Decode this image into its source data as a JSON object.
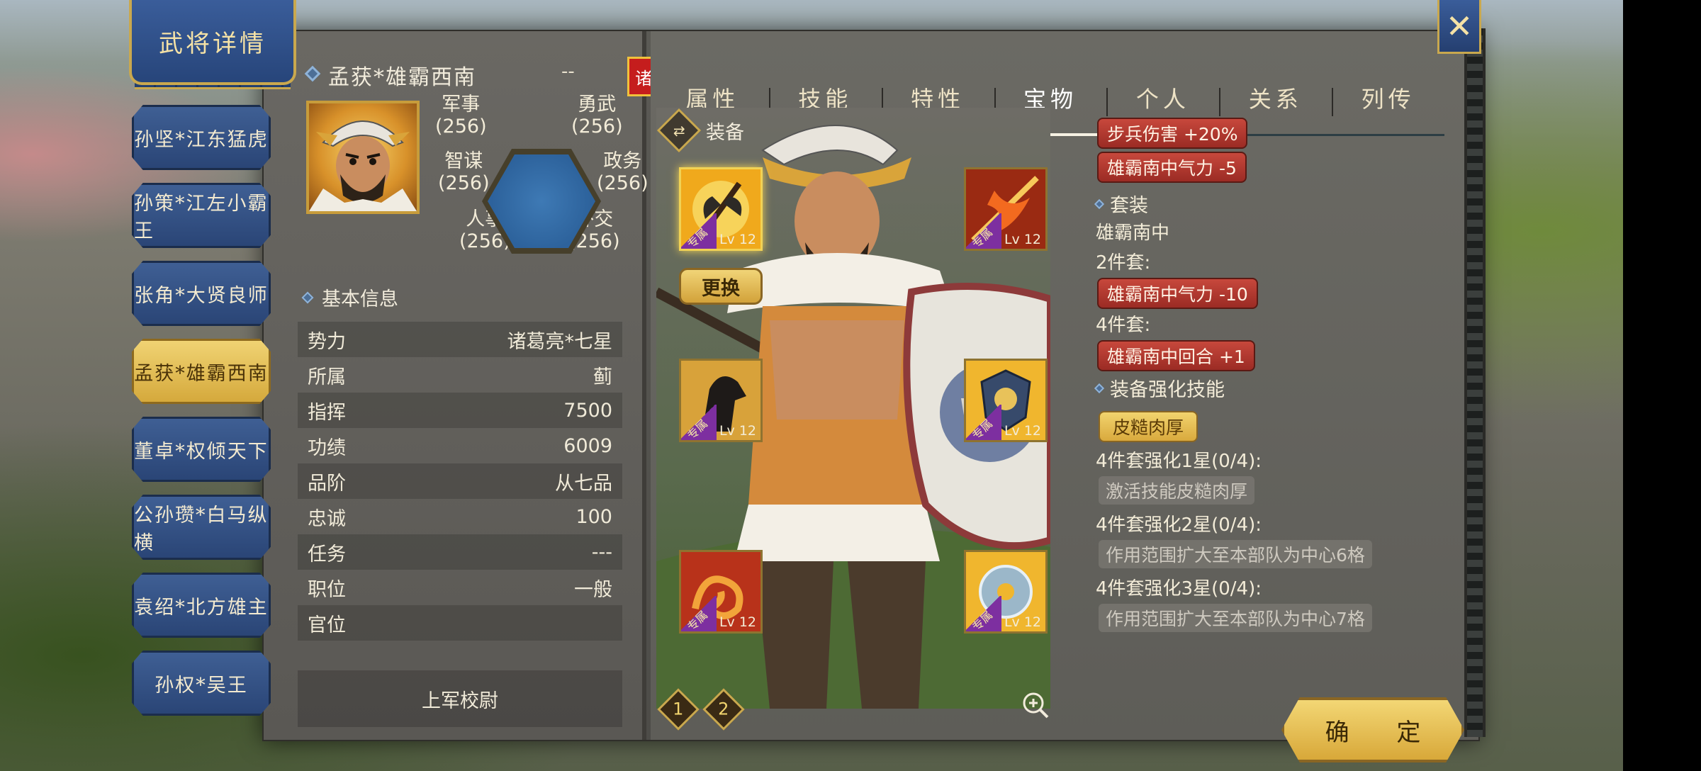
{
  "header": {
    "title": "武将详情"
  },
  "sidebar": {
    "heroes": [
      {
        "label": "孙坚*江东猛虎",
        "active": false
      },
      {
        "label": "孙策*江左小霸王",
        "active": false
      },
      {
        "label": "张角*大贤良师",
        "active": false
      },
      {
        "label": "孟获*雄霸西南",
        "active": true
      },
      {
        "label": "董卓*权倾天下",
        "active": false
      },
      {
        "label": "公孙瓒*白马纵横",
        "active": false
      },
      {
        "label": "袁绍*北方雄主",
        "active": false
      },
      {
        "label": "孙权*吴王",
        "active": false
      }
    ]
  },
  "hero": {
    "name": "孟获*雄霸西南",
    "dash": "--",
    "faction_badge": "诸",
    "stats": {
      "military": {
        "label": "军事",
        "value": "(256)"
      },
      "valor": {
        "label": "勇武",
        "value": "(256)"
      },
      "intellect": {
        "label": "智谋",
        "value": "(256)"
      },
      "politics": {
        "label": "政务",
        "value": "(256)"
      },
      "personnel": {
        "label": "人事",
        "value": "(256)"
      },
      "diplomacy": {
        "label": "外交",
        "value": "(256)"
      }
    }
  },
  "basic_info": {
    "title": "基本信息",
    "rows": [
      {
        "label": "势力",
        "value": "诸葛亮*七星"
      },
      {
        "label": "所属",
        "value": "蓟"
      },
      {
        "label": "指挥",
        "value": "7500"
      },
      {
        "label": "功绩",
        "value": "6009"
      },
      {
        "label": "品阶",
        "value": "从七品"
      },
      {
        "label": "忠诚",
        "value": "100"
      },
      {
        "label": "任务",
        "value": "---"
      },
      {
        "label": "职位",
        "value": "一般"
      },
      {
        "label": "官位",
        "value": ""
      }
    ],
    "rank": "上军校尉"
  },
  "tabs": [
    {
      "label": "属性",
      "active": false
    },
    {
      "label": "技能",
      "active": false
    },
    {
      "label": "特性",
      "active": false
    },
    {
      "label": "宝物",
      "active": true
    },
    {
      "label": "个人",
      "active": false
    },
    {
      "label": "关系",
      "active": false
    },
    {
      "label": "列传",
      "active": false
    }
  ],
  "equipment": {
    "title": "装备",
    "change_button": "更换",
    "exclusive_label": "专属",
    "slots": [
      {
        "icon": "axe-icon",
        "level": "Lv 12"
      },
      {
        "icon": "flame-spear-icon",
        "level": "Lv 12"
      },
      {
        "icon": "horse-icon",
        "level": "Lv 12"
      },
      {
        "icon": "emblem-icon",
        "level": "Lv 12"
      },
      {
        "icon": "dragon-icon",
        "level": "Lv 12"
      },
      {
        "icon": "jade-disc-icon",
        "level": "Lv 12"
      }
    ],
    "pages": [
      "1",
      "2"
    ]
  },
  "details": {
    "bonuses": [
      "步兵伤害 +20%",
      "雄霸南中气力 -5"
    ],
    "set_title": "套装",
    "set_name": "雄霸南中",
    "set2_label": "2件套:",
    "set2_bonus": "雄霸南中气力 -10",
    "set4_label": "4件套:",
    "set4_bonus": "雄霸南中回合 +1",
    "enhance_title": "装备强化技能",
    "enhance_skill": "皮糙肉厚",
    "star1_label": "4件套强化1星(0/4):",
    "star1_desc": "激活技能皮糙肉厚",
    "star2_label": "4件套强化2星(0/4):",
    "star2_desc": "作用范围扩大至本部队为中心6格",
    "star3_label": "4件套强化3星(0/4):",
    "star3_desc": "作用范围扩大至本部队为中心7格"
  },
  "footer": {
    "confirm": "确 定"
  }
}
